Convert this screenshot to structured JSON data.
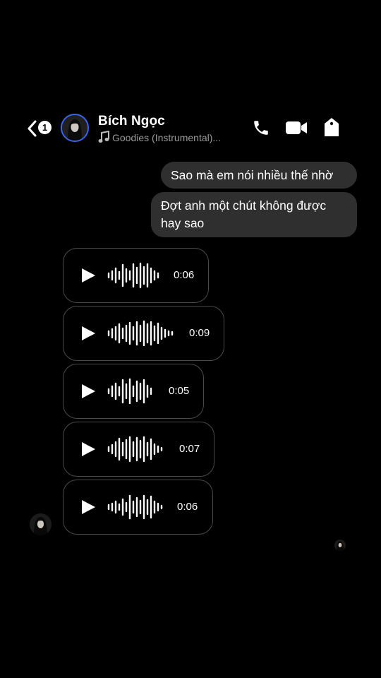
{
  "header": {
    "back_badge": "1",
    "contact_name": "Bích Ngọc",
    "now_playing": "Goodies (Instrumental)...",
    "icons": [
      "phone-icon",
      "video-call-icon",
      "tag-icon"
    ]
  },
  "messages": [
    {
      "from": "me",
      "text": "Sao mà em nói nhiều thế nhờ"
    },
    {
      "from": "me",
      "lines": [
        "Đợt anh một chút không được",
        "hay sao"
      ]
    }
  ],
  "voice_messages": [
    {
      "duration": "0:06"
    },
    {
      "duration": "0:09"
    },
    {
      "duration": "0:05"
    },
    {
      "duration": "0:07"
    },
    {
      "duration": "0:06"
    }
  ],
  "colors": {
    "bubble": "#2f2f2f",
    "avatar_ring": "#3a66f0",
    "background": "#000000"
  }
}
